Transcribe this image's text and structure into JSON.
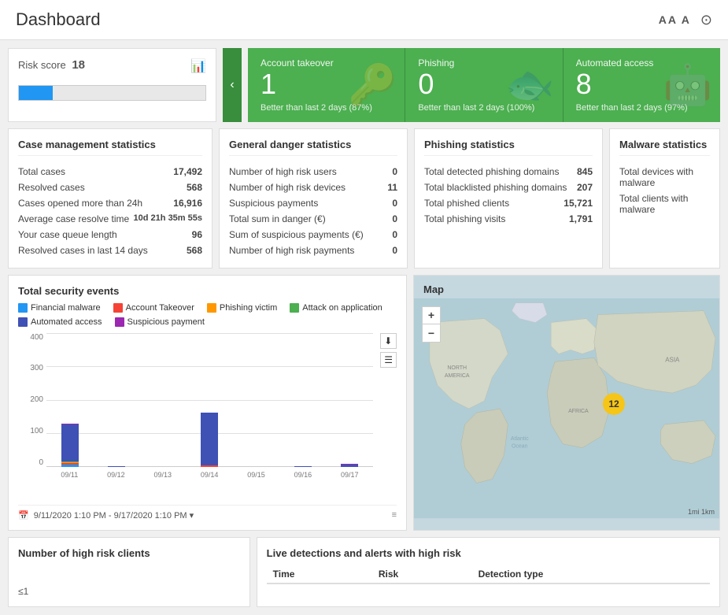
{
  "header": {
    "title": "Dashboard",
    "controls": [
      "AA A",
      "⊙"
    ]
  },
  "risk_card": {
    "title": "Risk score",
    "score": 18,
    "bar_percent": 18,
    "icon": "📊"
  },
  "green_cards": [
    {
      "id": "account-takeover",
      "label": "Account takeover",
      "value": "1",
      "subtitle": "Better than last 2 days (87%)",
      "icon": "🔑"
    },
    {
      "id": "phishing",
      "label": "Phishing",
      "value": "0",
      "subtitle": "Better than last 2 days (100%)",
      "icon": "🐟"
    },
    {
      "id": "automated-access",
      "label": "Automated access",
      "value": "8",
      "subtitle": "Better than last 2 days (97%)",
      "icon": "🤖"
    }
  ],
  "case_mgmt": {
    "title": "Case management statistics",
    "rows": [
      {
        "label": "Total cases",
        "value": "17,492"
      },
      {
        "label": "Resolved cases",
        "value": "568"
      },
      {
        "label": "Cases opened more than 24h",
        "value": "16,916"
      },
      {
        "label": "Average case resolve time",
        "value": "10d 21h 35m 55s"
      },
      {
        "label": "Your case queue length",
        "value": "96"
      },
      {
        "label": "Resolved cases in last 14 days",
        "value": "568"
      }
    ]
  },
  "general_danger": {
    "title": "General danger statistics",
    "rows": [
      {
        "label": "Number of high risk users",
        "value": "0"
      },
      {
        "label": "Number of high risk devices",
        "value": "11"
      },
      {
        "label": "Suspicious payments",
        "value": "0"
      },
      {
        "label": "Total sum in danger (€)",
        "value": "0"
      },
      {
        "label": "Sum of suspicious payments (€)",
        "value": "0"
      },
      {
        "label": "Number of high risk payments",
        "value": "0"
      }
    ]
  },
  "phishing_stats": {
    "title": "Phishing statistics",
    "rows": [
      {
        "label": "Total detected phishing domains",
        "value": "845"
      },
      {
        "label": "Total blacklisted phishing domains",
        "value": "207"
      },
      {
        "label": "Total phished clients",
        "value": "15,721"
      },
      {
        "label": "Total phishing visits",
        "value": "1,791"
      }
    ]
  },
  "malware_stats": {
    "title": "Malware statistics",
    "rows": [
      {
        "label": "Total devices with malware",
        "value": ""
      },
      {
        "label": "Total clients with malware",
        "value": ""
      }
    ]
  },
  "chart": {
    "title": "Total security events",
    "y_labels": [
      "400",
      "300",
      "200",
      "100",
      "0"
    ],
    "x_labels": [
      "09/11",
      "09/12",
      "09/13",
      "09/14",
      "09/15",
      "09/16",
      "09/17"
    ],
    "bars": [
      {
        "date": "09/11",
        "segments": [
          {
            "color": "#2196f3",
            "height": 8
          },
          {
            "color": "#f44336",
            "height": 5
          },
          {
            "color": "#ff9800",
            "height": 3
          },
          {
            "color": "#4caf50",
            "height": 2
          },
          {
            "color": "#3f51b5",
            "height": 110
          },
          {
            "color": "#9c27b0",
            "height": 2
          }
        ]
      },
      {
        "date": "09/12",
        "segments": [
          {
            "color": "#2196f3",
            "height": 0
          },
          {
            "color": "#f44336",
            "height": 0
          },
          {
            "color": "#ff9800",
            "height": 0
          },
          {
            "color": "#4caf50",
            "height": 0
          },
          {
            "color": "#3f51b5",
            "height": 2
          },
          {
            "color": "#9c27b0",
            "height": 0
          }
        ]
      },
      {
        "date": "09/13",
        "segments": [
          {
            "color": "#2196f3",
            "height": 0
          },
          {
            "color": "#f44336",
            "height": 0
          },
          {
            "color": "#ff9800",
            "height": 0
          },
          {
            "color": "#4caf50",
            "height": 0
          },
          {
            "color": "#3f51b5",
            "height": 1
          },
          {
            "color": "#9c27b0",
            "height": 0
          }
        ]
      },
      {
        "date": "09/14",
        "segments": [
          {
            "color": "#2196f3",
            "height": 0
          },
          {
            "color": "#f44336",
            "height": 5
          },
          {
            "color": "#ff9800",
            "height": 0
          },
          {
            "color": "#4caf50",
            "height": 0
          },
          {
            "color": "#3f51b5",
            "height": 158
          },
          {
            "color": "#9c27b0",
            "height": 0
          }
        ]
      },
      {
        "date": "09/15",
        "segments": [
          {
            "color": "#2196f3",
            "height": 0
          },
          {
            "color": "#f44336",
            "height": 1
          },
          {
            "color": "#ff9800",
            "height": 0
          },
          {
            "color": "#4caf50",
            "height": 0
          },
          {
            "color": "#3f51b5",
            "height": 1
          },
          {
            "color": "#9c27b0",
            "height": 0
          }
        ]
      },
      {
        "date": "09/16",
        "segments": [
          {
            "color": "#2196f3",
            "height": 0
          },
          {
            "color": "#f44336",
            "height": 0
          },
          {
            "color": "#ff9800",
            "height": 0
          },
          {
            "color": "#4caf50",
            "height": 0
          },
          {
            "color": "#3f51b5",
            "height": 2
          },
          {
            "color": "#9c27b0",
            "height": 1
          }
        ]
      },
      {
        "date": "09/17",
        "segments": [
          {
            "color": "#2196f3",
            "height": 0
          },
          {
            "color": "#f44336",
            "height": 0
          },
          {
            "color": "#ff9800",
            "height": 0
          },
          {
            "color": "#4caf50",
            "height": 0
          },
          {
            "color": "#3f51b5",
            "height": 8
          },
          {
            "color": "#9c27b0",
            "height": 3
          }
        ]
      }
    ],
    "legend": [
      {
        "label": "Financial malware",
        "color": "#2196f3"
      },
      {
        "label": "Account Takeover",
        "color": "#f44336"
      },
      {
        "label": "Phishing victim",
        "color": "#ff9800"
      },
      {
        "label": "Attack on application",
        "color": "#4caf50"
      },
      {
        "label": "Automated access",
        "color": "#3f51b5"
      },
      {
        "label": "Suspicious payment",
        "color": "#9c27b0"
      }
    ],
    "footer_date": "9/11/2020 1:10 PM - 9/17/2020 1:10 PM ▾"
  },
  "map": {
    "title": "Map",
    "cluster_value": "12",
    "zoom_in": "+",
    "zoom_out": "−"
  },
  "bottom_left": {
    "title": "Number of high risk clients",
    "value": "≤1"
  },
  "live_detections": {
    "title": "Live detections and alerts with high risk",
    "columns": [
      "Time",
      "Risk",
      "Detection type"
    ]
  }
}
